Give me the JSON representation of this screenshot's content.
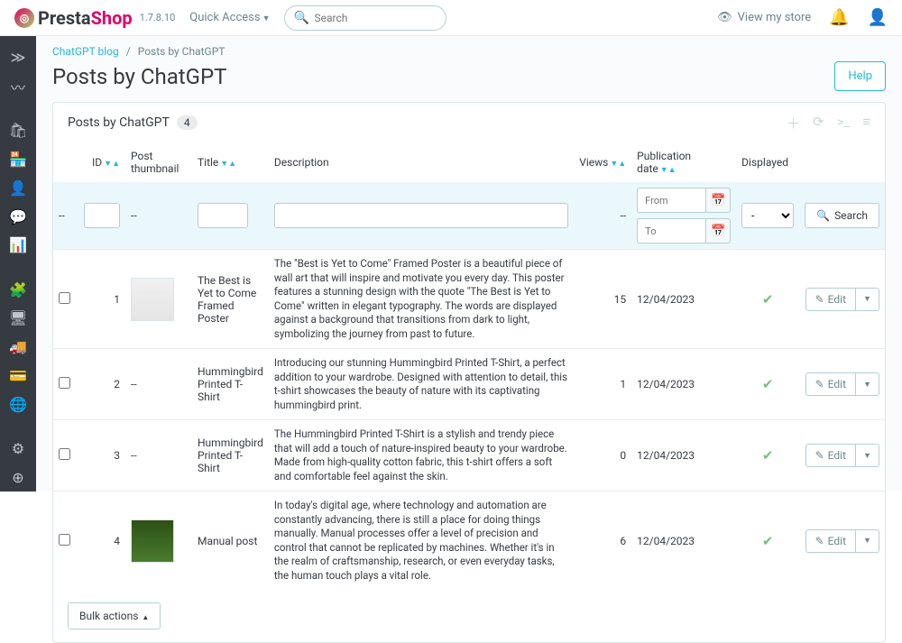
{
  "top": {
    "brand1": "Presta",
    "brand2": "Shop",
    "version": "1.7.8.10",
    "quick_access": "Quick Access",
    "search_placeholder": "Search",
    "view_store": "View my store"
  },
  "breadcrumb": {
    "a": "ChatGPT blog",
    "b": "Posts by ChatGPT"
  },
  "title": "Posts by ChatGPT",
  "help": "Help",
  "panel_title": "Posts by ChatGPT",
  "count": "4",
  "cols": {
    "id": "ID",
    "thumb": "Post thumbnail",
    "title": "Title",
    "desc": "Description",
    "views": "Views",
    "pub": "Publication date",
    "disp": "Displayed"
  },
  "filters": {
    "from": "From",
    "to": "To",
    "dash": "-",
    "ddash": "--",
    "search": "Search"
  },
  "edit_label": "Edit",
  "bulk": "Bulk actions",
  "rows": [
    {
      "id": "1",
      "thumb": "tee",
      "title": "The Best is Yet to Come Framed Poster",
      "desc": "The \"Best is Yet to Come\" Framed Poster is a beautiful piece of wall art that will inspire and motivate you every day. This poster features a stunning design with the quote \"The Best is Yet to Come\" written in elegant typography. The words are displayed against a background that transitions from dark to light, symbolizing the journey from past to future.",
      "views": "15",
      "pub": "12/04/2023",
      "disp": true
    },
    {
      "id": "2",
      "thumb": "--",
      "title": "Hummingbird Printed T-Shirt",
      "desc": "Introducing our stunning Hummingbird Printed T-Shirt, a perfect addition to your wardrobe. Designed with attention to detail, this t-shirt showcases the beauty of nature with its captivating hummingbird print.",
      "views": "1",
      "pub": "12/04/2023",
      "disp": true
    },
    {
      "id": "3",
      "thumb": "--",
      "title": "Hummingbird Printed T-Shirt",
      "desc": "The Hummingbird Printed T-Shirt is a stylish and trendy piece that will add a touch of nature-inspired beauty to your wardrobe. Made from high-quality cotton fabric, this t-shirt offers a soft and comfortable feel against the skin.",
      "views": "0",
      "pub": "12/04/2023",
      "disp": true
    },
    {
      "id": "4",
      "thumb": "green",
      "title": "Manual post",
      "desc": "In today's digital age, where technology and automation are constantly advancing, there is still a place for doing things manually. Manual processes offer a level of precision and control that cannot be replicated by machines. Whether it's in the realm of craftsmanship, research, or even everyday tasks, the human touch plays a vital role.",
      "views": "6",
      "pub": "12/04/2023",
      "disp": true
    }
  ]
}
